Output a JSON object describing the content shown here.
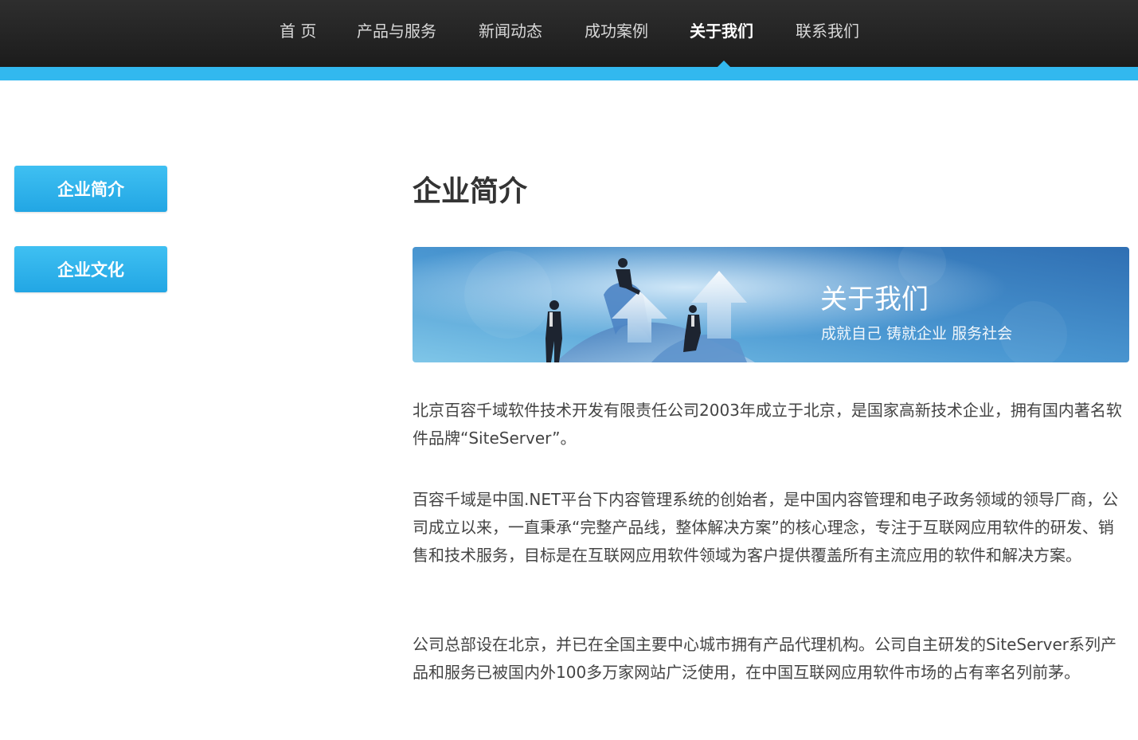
{
  "nav": {
    "items": [
      {
        "label": "首 页"
      },
      {
        "label": "产品与服务"
      },
      {
        "label": "新闻动态"
      },
      {
        "label": "成功案例"
      },
      {
        "label": "关于我们"
      },
      {
        "label": "联系我们"
      }
    ],
    "active_index": 4
  },
  "sidebar": {
    "items": [
      {
        "label": "企业简介"
      },
      {
        "label": "企业文化"
      }
    ]
  },
  "main": {
    "title": "企业简介",
    "banner": {
      "title": "关于我们",
      "subtitle": "成就自己 铸就企业 服务社会"
    },
    "paragraphs": [
      "北京百容千域软件技术开发有限责任公司2003年成立于北京，是国家高新技术企业，拥有国内著名软件品牌“SiteServer”。",
      "百容千域是中国.NET平台下内容管理系统的创始者，是中国内容管理和电子政务领域的领导厂商，公司成立以来，一直秉承“完整产品线，整体解决方案”的核心理念，专注于互联网应用软件的研发、销售和技术服务，目标是在互联网应用软件领域为客户提供覆盖所有主流应用的软件和解决方案。",
      "公司总部设在北京，并已在全国主要中心城市拥有产品代理机构。公司自主研发的SiteServer系列产品和服务已被国内外100多万家网站广泛使用，在中国互联网应用软件市场的占有率名列前茅。"
    ]
  },
  "colors": {
    "accent": "#32b8ef",
    "nav_bg": "#222222",
    "button": "#2ab0ea",
    "text": "#444444"
  }
}
